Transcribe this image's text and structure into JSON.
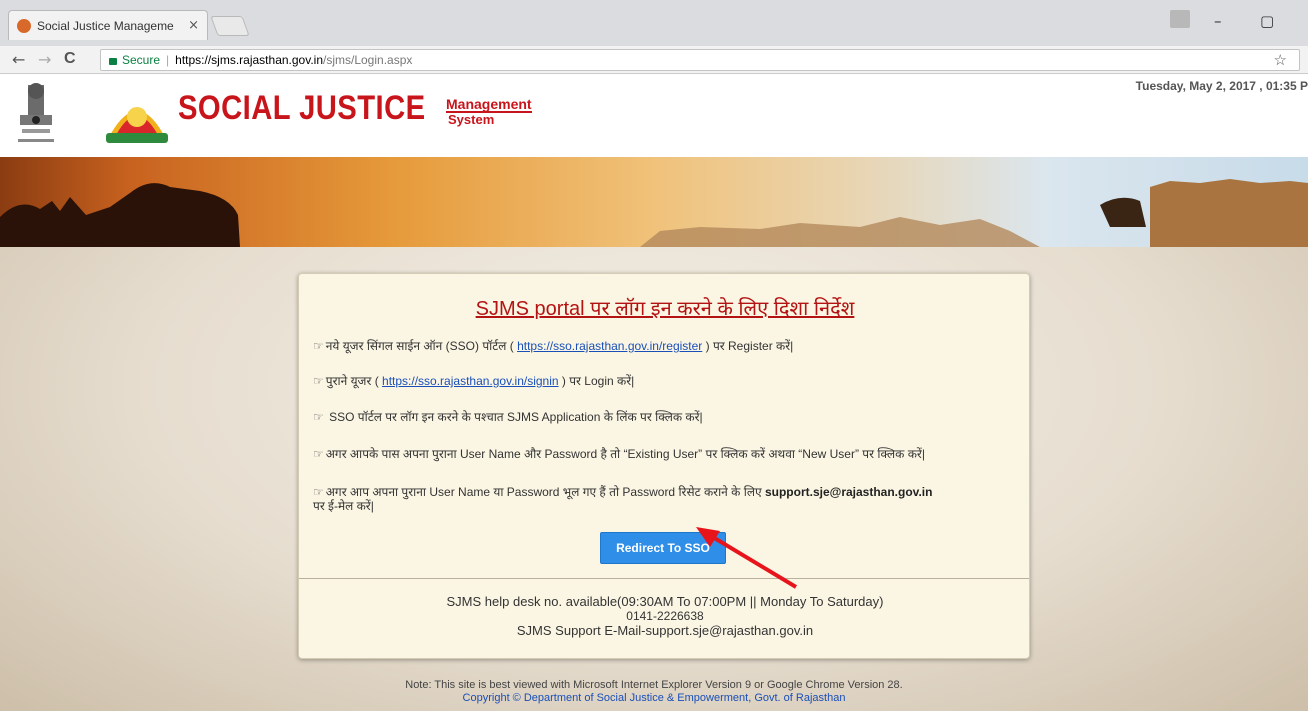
{
  "browser": {
    "tab_title": "Social Justice Manageme",
    "tab_close": "×",
    "secure_label": "Secure",
    "url_host": "https://sjms.rajasthan.gov.in",
    "url_path": "/sjms/Login.aspx",
    "back_glyph": "←",
    "forward_glyph": "→",
    "reload_glyph": "C",
    "star_glyph": "☆",
    "minimize_glyph": "–",
    "restore_glyph": "▢"
  },
  "header": {
    "brand_title": "SOCIAL JUSTICE",
    "brand_management": "Management",
    "brand_system": "System",
    "datetime": "Tuesday, May 2, 2017 , 01:35 P"
  },
  "card": {
    "title": "SJMS portal पर लॉग इन करने के लिए दिशा निर्देश",
    "bullet": "☞",
    "items": [
      {
        "pre": "नये यूजर सिंगल साईन ऑन (SSO) पॉर्टल ( ",
        "link": "https://sso.rajasthan.gov.in/register",
        "post": " ) पर Register करें|"
      },
      {
        "pre": "पुराने यूजर ( ",
        "link": "https://sso.rajasthan.gov.in/signin",
        "post": " ) पर Login करें|"
      },
      {
        "pre": " SSO पॉर्टल पर लॉग इन करने के पश्चात SJMS Application के लिंक पर क्लिक करें|"
      },
      {
        "pre": "अगर आपके पास अपना पुराना User Name और Password है तो “Existing User” पर क्लिक करें अथवा “New User” पर क्लिक करें|"
      },
      {
        "pre": "अगर आप अपना पुराना User Name या Password भूल गए हैं तो Password रिसेट कराने के लिए ",
        "bold": "support.sje@rajasthan.gov.in",
        "post2": "पर ई-मेल करें|"
      }
    ],
    "button_label": "Redirect To SSO",
    "help_line1": "SJMS help desk no. available(09:30AM To 07:00PM || Monday To Saturday)",
    "help_line2": "0141-2226638",
    "help_line3": "SJMS Support E-Mail-support.sje@rajasthan.gov.in"
  },
  "footer": {
    "note": "Note: This site is best viewed with Microsoft Internet Explorer Version 9 or Google Chrome Version 28.",
    "copyright": "Copyright © Department of Social Justice & Empowerment, Govt. of Rajasthan"
  },
  "colors": {
    "brand_red": "#c8151b",
    "button_blue": "#2f8ee7",
    "link_blue": "#1a4fb8",
    "annotation_arrow": "#e8141b"
  }
}
